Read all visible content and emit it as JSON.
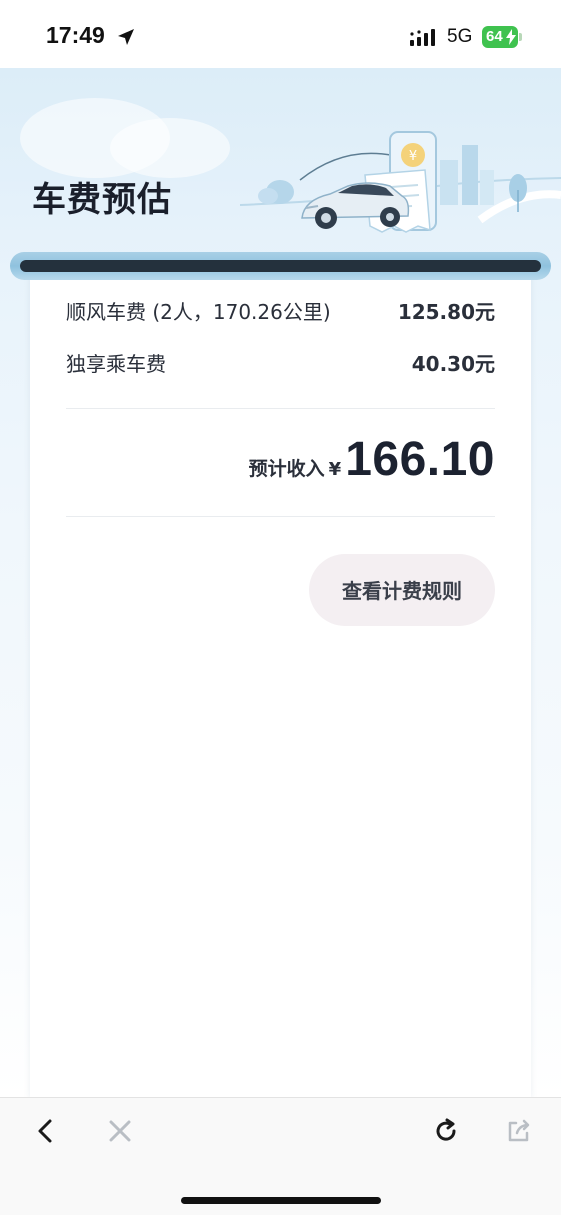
{
  "status_bar": {
    "time": "17:49",
    "network": "5G",
    "battery": "64"
  },
  "header": {
    "title": "车费预估"
  },
  "fees": {
    "items": [
      {
        "label": "顺风车费 (2人，170.26公里)",
        "amount": "125.80元"
      },
      {
        "label": "独享乘车费",
        "amount": "40.30元"
      }
    ]
  },
  "total": {
    "label": "预计收入",
    "currency": "¥",
    "amount": "166.10"
  },
  "rules_button": {
    "label": "查看计费规则"
  },
  "browser_toolbar": {
    "icons": [
      "back-icon",
      "close-icon",
      "refresh-icon",
      "share-icon"
    ]
  },
  "colors": {
    "battery": "#3fc24f",
    "banner": "#dcedf8",
    "button_bg": "#f4eff2",
    "text_primary": "#1c2230"
  }
}
